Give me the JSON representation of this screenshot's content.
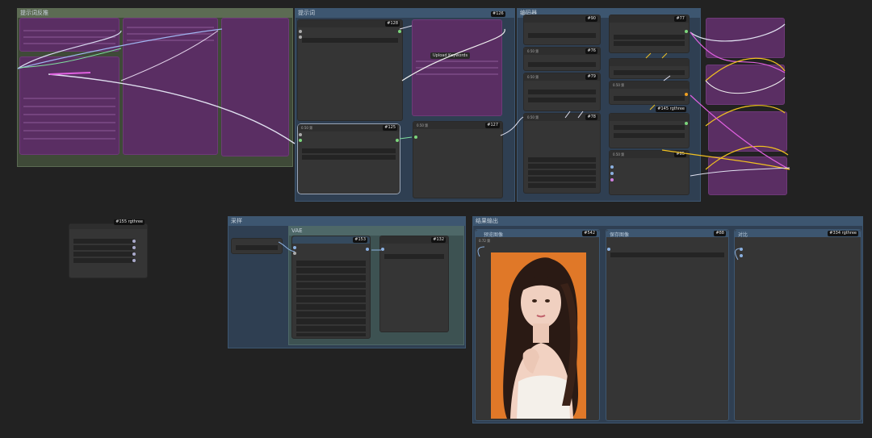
{
  "groups": {
    "prompt_adjust": {
      "title": "提示词反推"
    },
    "reverse_prompt": {
      "title": "提示词"
    },
    "encoder": {
      "title": "编码器"
    },
    "sampler": {
      "title": "采样"
    },
    "vae": {
      "title": "VAE"
    },
    "result": {
      "title": "结果输出"
    }
  },
  "node_badges": {
    "n128": "#128",
    "n126": "#126",
    "n125": "#125",
    "n127": "#127",
    "n90": "#90",
    "n77": "#77",
    "n76": "#76",
    "n79": "#79",
    "n78": "#78",
    "n145": "#145 rgthree",
    "n85": "#85",
    "n155": "#155 rgthree",
    "n153": "#153",
    "n132": "#132",
    "n542": "#542",
    "n88": "#88",
    "n334": "#334 rgthree"
  },
  "result_nodes": {
    "preview_label": "预览图像",
    "save_label": "保存图像",
    "compare_label": "对比"
  },
  "tooltip": {
    "upload": "Upload Keywords"
  },
  "small_labels": {
    "seed": "0.50 第",
    "cfg1": "0.50 第",
    "cfg2": "0.50 第",
    "cfg3": "0.50 第",
    "steps": "0.50 第",
    "denoise": "0.50 第",
    "scale": "0.72 第",
    "sampler_lbl": "0.50 第",
    "ratio": "0.50 第"
  },
  "colors": {
    "background": "#222222",
    "group_green": "#5c6b53",
    "group_blue": "#2f3f52",
    "group_teal": "#3d5252",
    "node": "#353535",
    "magenta_node": "#5a2e63",
    "wire_white": "#e0e0f0",
    "wire_yellow": "#f0c020",
    "wire_pink": "#e060e0",
    "image_bg": "#e07828"
  },
  "icons": [
    "collapse-dot-icon",
    "connection-dot-icon",
    "portrait-image"
  ]
}
